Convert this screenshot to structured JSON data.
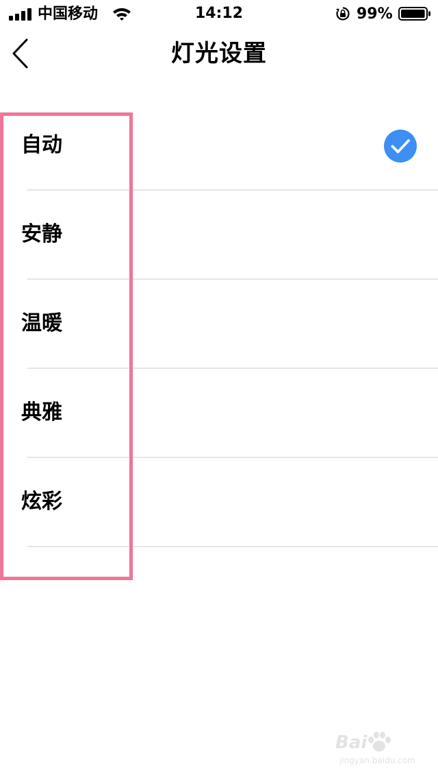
{
  "status_bar": {
    "carrier": "中国移动",
    "time": "14:12",
    "battery_percent": "99%",
    "battery_level": 0.99,
    "signal_bars": 4,
    "icons": [
      "signal-icon",
      "wifi-icon",
      "rotation-lock-icon",
      "battery-icon"
    ]
  },
  "nav": {
    "title": "灯光设置",
    "back_icon": "chevron-left-icon"
  },
  "options": [
    {
      "label": "自动",
      "selected": true
    },
    {
      "label": "安静",
      "selected": false
    },
    {
      "label": "温暖",
      "selected": false
    },
    {
      "label": "典雅",
      "selected": false
    },
    {
      "label": "炫彩",
      "selected": false
    }
  ],
  "colors": {
    "accent": "#3d8ef5",
    "highlight": "#f07598",
    "divider": "#e6e6e6",
    "text": "#000000",
    "background": "#ffffff"
  },
  "watermark": {
    "brand": "Bai",
    "url": "jingyan.baidu.com"
  }
}
